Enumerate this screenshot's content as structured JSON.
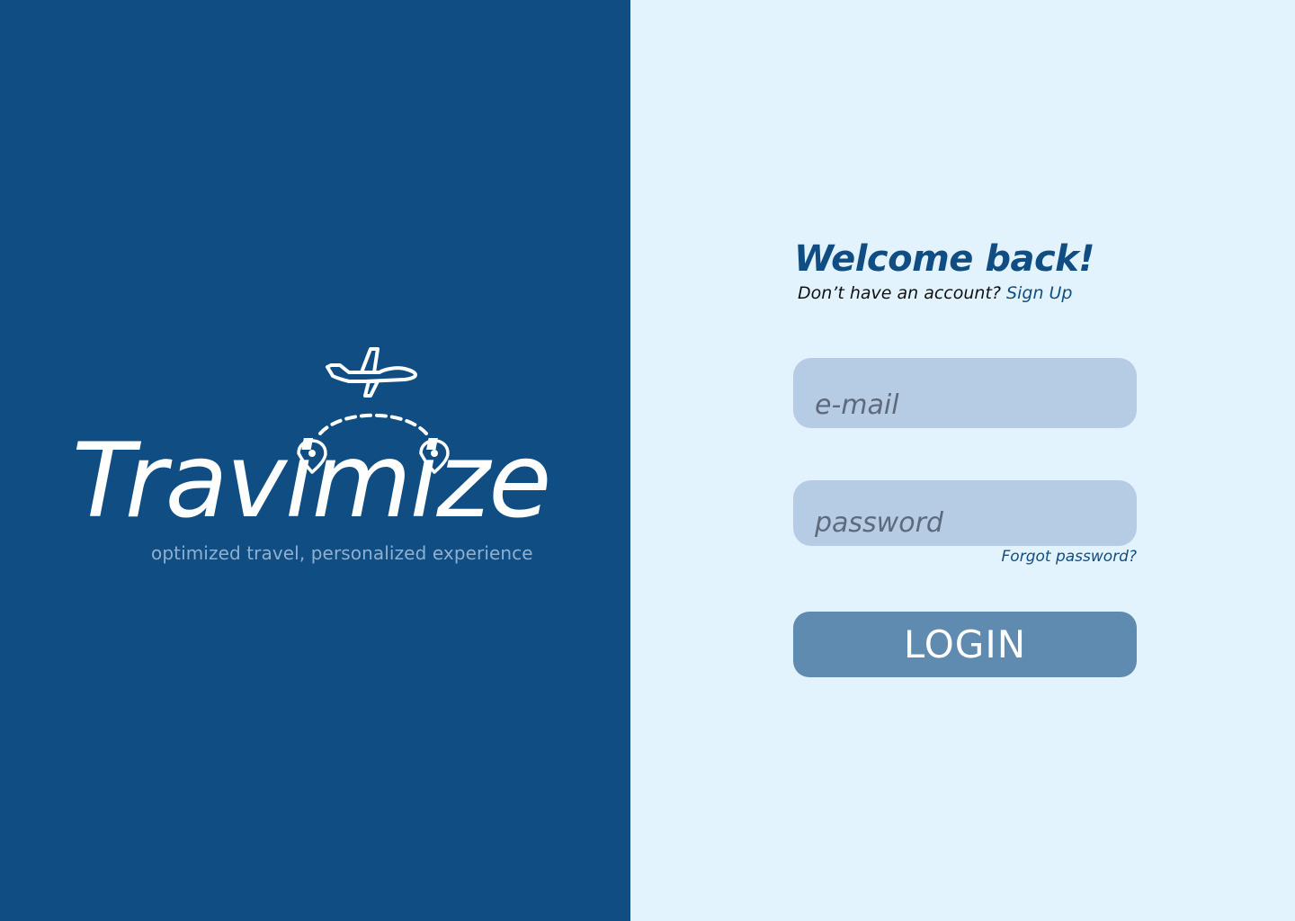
{
  "brand": {
    "name": "Travimize",
    "tagline": "optimized travel, personalized experience",
    "logo_icons": [
      "airplane-icon",
      "map-pin-icon",
      "map-pin-icon"
    ]
  },
  "login_form": {
    "title": "Welcome back!",
    "signup_prompt": "Don’t have an account?",
    "signup_link": "Sign Up",
    "email_placeholder": "e-mail",
    "password_placeholder": "password",
    "forgot_password": "Forgot password?",
    "login_button": "LOGIN"
  },
  "colors": {
    "brand_dark_blue": "#104d82",
    "background_light": "#e3f3fe",
    "field_fill": "#b6cce4",
    "button_fill": "#5f8bb1",
    "tagline": "#8fb0d0"
  }
}
